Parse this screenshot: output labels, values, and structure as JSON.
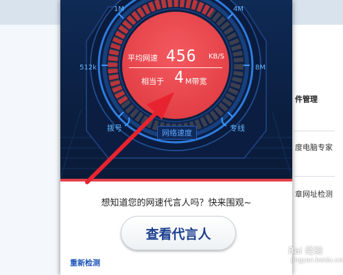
{
  "background": {
    "right_items": [
      "件管理",
      "度电脑专家",
      "章网址检测"
    ]
  },
  "meter": {
    "scale_labels": {
      "top_left": "1M",
      "top_right": "4M",
      "left": "512k",
      "right": "8M",
      "bottom_left": "拨号",
      "bottom_right": "专线"
    },
    "caption": "网络速度",
    "average_label": "平均网速",
    "average_value": "456",
    "average_unit": "KB/S",
    "equivalent_label": "相当于",
    "equivalent_value": "4",
    "equivalent_unit": "M带宽"
  },
  "lower": {
    "question": "想知道您的网速代言人吗？快来围观~",
    "view_button": "查看代言人",
    "retest_link": "重新检测"
  },
  "watermark": {
    "text": "Bai 经验",
    "sub": "jingyan.baidu.com"
  },
  "colors": {
    "panel_dark": "#0f2a55",
    "gauge_red": "#e9484f",
    "accent_blue": "#2d8cff",
    "arrow_red": "#e8232f",
    "link_blue": "#1d55b8"
  }
}
